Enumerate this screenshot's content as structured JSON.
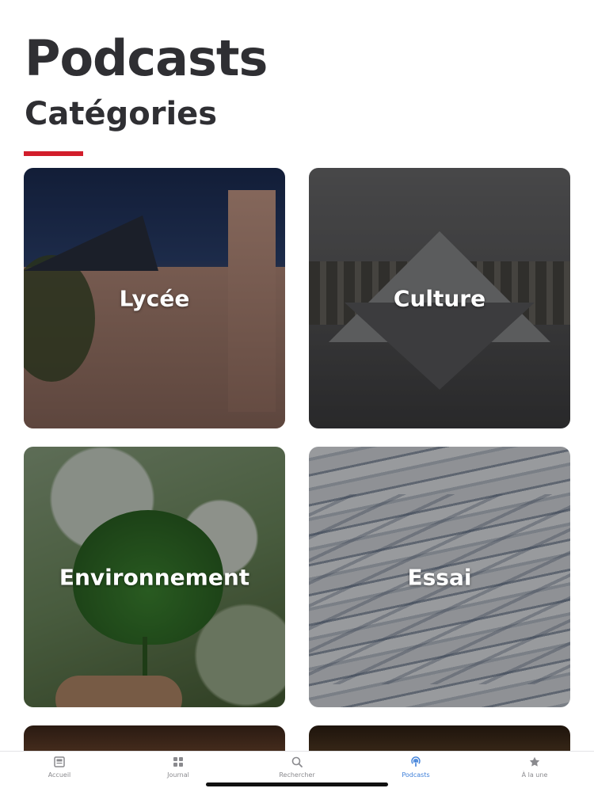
{
  "header": {
    "title": "Podcasts",
    "subtitle": "Catégories"
  },
  "colors": {
    "accent": "#d21e2b",
    "tab_active": "#3d7fd9",
    "tab_inactive": "#8a8a8e"
  },
  "categories": [
    {
      "label": "Lycée"
    },
    {
      "label": "Culture"
    },
    {
      "label": "Environnement"
    },
    {
      "label": "Essai"
    }
  ],
  "tabbar": {
    "items": [
      {
        "label": "Accueil",
        "icon": "newspaper-icon"
      },
      {
        "label": "Journal",
        "icon": "grid-icon"
      },
      {
        "label": "Rechercher",
        "icon": "search-icon"
      },
      {
        "label": "Podcasts",
        "icon": "podcast-icon",
        "active": true
      },
      {
        "label": "À la une",
        "icon": "star-icon"
      }
    ]
  }
}
